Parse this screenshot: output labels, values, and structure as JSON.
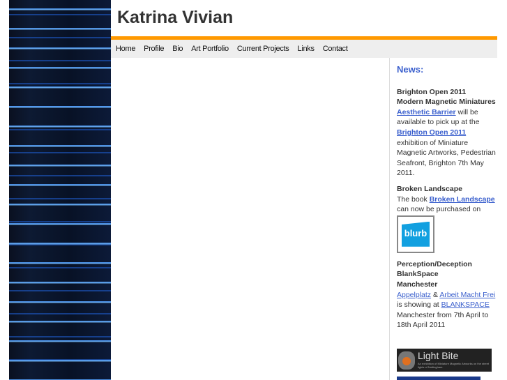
{
  "site_title": "Katrina Vivian",
  "nav": [
    "Home",
    "Profile",
    "Bio",
    "Art Portfolio",
    "Current Projects",
    "Links",
    "Contact"
  ],
  "news": {
    "heading": "News:",
    "item1": {
      "title1": "Brighton Open 2011",
      "title2": "Modern Magnetic Miniatures",
      "link1": "Aesthetic Barrier",
      "text1": " will be available to pick up at the",
      "link2": "Brighton Open 2011",
      "text2": "exhibition of Miniature Magnetic Artworks, Pedestrian Seafront, Brighton 7th May 2011."
    },
    "item2": {
      "title": "Broken Landscape",
      "text1": "The book ",
      "link": "Broken Landscape",
      "text2": "can now be purchased on",
      "blurb": "blurb"
    },
    "item3": {
      "title1": "Perception/Deception",
      "title2": "BlankSpace",
      "title3": "Manchester",
      "link1": "Appelplatz",
      "amp": " & ",
      "link2": "Arbeit Macht Frei",
      "text1": "is showing at ",
      "link3": "BLANKSPACE",
      "text2": "Manchester from 7th April to 18th April 2011"
    },
    "banner": {
      "title": "Light Bite",
      "caption": "An exhibition of Miniature Magnetic Artworks on the street lights of Nottingham."
    }
  }
}
